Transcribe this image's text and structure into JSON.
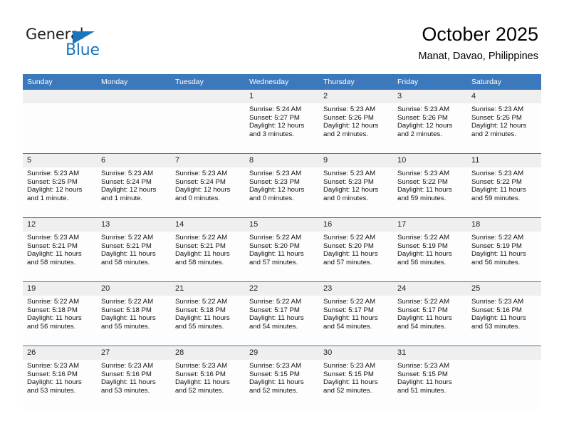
{
  "logo": {
    "word_top": "General",
    "word_bottom": "Blue",
    "triangle_color": "#1b75bb",
    "text_color": "#231f20"
  },
  "header": {
    "title": "October 2025",
    "subtitle": "Manat, Davao, Philippines"
  },
  "colors": {
    "header_bar": "#3c78bc",
    "header_text": "#ffffff",
    "daynum_band": "#efefef",
    "row_divider": "#3c78bc",
    "cell_background": "#fdfdfd",
    "body_text": "#111111"
  },
  "weekday_headers": [
    "Sunday",
    "Monday",
    "Tuesday",
    "Wednesday",
    "Thursday",
    "Friday",
    "Saturday"
  ],
  "calendar": {
    "weeks": [
      [
        {
          "day": "",
          "sunrise": "",
          "sunset": "",
          "daylight1": "",
          "daylight2": ""
        },
        {
          "day": "",
          "sunrise": "",
          "sunset": "",
          "daylight1": "",
          "daylight2": ""
        },
        {
          "day": "",
          "sunrise": "",
          "sunset": "",
          "daylight1": "",
          "daylight2": ""
        },
        {
          "day": "1",
          "sunrise": "Sunrise: 5:24 AM",
          "sunset": "Sunset: 5:27 PM",
          "daylight1": "Daylight: 12 hours",
          "daylight2": "and 3 minutes."
        },
        {
          "day": "2",
          "sunrise": "Sunrise: 5:23 AM",
          "sunset": "Sunset: 5:26 PM",
          "daylight1": "Daylight: 12 hours",
          "daylight2": "and 2 minutes."
        },
        {
          "day": "3",
          "sunrise": "Sunrise: 5:23 AM",
          "sunset": "Sunset: 5:26 PM",
          "daylight1": "Daylight: 12 hours",
          "daylight2": "and 2 minutes."
        },
        {
          "day": "4",
          "sunrise": "Sunrise: 5:23 AM",
          "sunset": "Sunset: 5:25 PM",
          "daylight1": "Daylight: 12 hours",
          "daylight2": "and 2 minutes."
        }
      ],
      [
        {
          "day": "5",
          "sunrise": "Sunrise: 5:23 AM",
          "sunset": "Sunset: 5:25 PM",
          "daylight1": "Daylight: 12 hours",
          "daylight2": "and 1 minute."
        },
        {
          "day": "6",
          "sunrise": "Sunrise: 5:23 AM",
          "sunset": "Sunset: 5:24 PM",
          "daylight1": "Daylight: 12 hours",
          "daylight2": "and 1 minute."
        },
        {
          "day": "7",
          "sunrise": "Sunrise: 5:23 AM",
          "sunset": "Sunset: 5:24 PM",
          "daylight1": "Daylight: 12 hours",
          "daylight2": "and 0 minutes."
        },
        {
          "day": "8",
          "sunrise": "Sunrise: 5:23 AM",
          "sunset": "Sunset: 5:23 PM",
          "daylight1": "Daylight: 12 hours",
          "daylight2": "and 0 minutes."
        },
        {
          "day": "9",
          "sunrise": "Sunrise: 5:23 AM",
          "sunset": "Sunset: 5:23 PM",
          "daylight1": "Daylight: 12 hours",
          "daylight2": "and 0 minutes."
        },
        {
          "day": "10",
          "sunrise": "Sunrise: 5:23 AM",
          "sunset": "Sunset: 5:22 PM",
          "daylight1": "Daylight: 11 hours",
          "daylight2": "and 59 minutes."
        },
        {
          "day": "11",
          "sunrise": "Sunrise: 5:23 AM",
          "sunset": "Sunset: 5:22 PM",
          "daylight1": "Daylight: 11 hours",
          "daylight2": "and 59 minutes."
        }
      ],
      [
        {
          "day": "12",
          "sunrise": "Sunrise: 5:23 AM",
          "sunset": "Sunset: 5:21 PM",
          "daylight1": "Daylight: 11 hours",
          "daylight2": "and 58 minutes."
        },
        {
          "day": "13",
          "sunrise": "Sunrise: 5:22 AM",
          "sunset": "Sunset: 5:21 PM",
          "daylight1": "Daylight: 11 hours",
          "daylight2": "and 58 minutes."
        },
        {
          "day": "14",
          "sunrise": "Sunrise: 5:22 AM",
          "sunset": "Sunset: 5:21 PM",
          "daylight1": "Daylight: 11 hours",
          "daylight2": "and 58 minutes."
        },
        {
          "day": "15",
          "sunrise": "Sunrise: 5:22 AM",
          "sunset": "Sunset: 5:20 PM",
          "daylight1": "Daylight: 11 hours",
          "daylight2": "and 57 minutes."
        },
        {
          "day": "16",
          "sunrise": "Sunrise: 5:22 AM",
          "sunset": "Sunset: 5:20 PM",
          "daylight1": "Daylight: 11 hours",
          "daylight2": "and 57 minutes."
        },
        {
          "day": "17",
          "sunrise": "Sunrise: 5:22 AM",
          "sunset": "Sunset: 5:19 PM",
          "daylight1": "Daylight: 11 hours",
          "daylight2": "and 56 minutes."
        },
        {
          "day": "18",
          "sunrise": "Sunrise: 5:22 AM",
          "sunset": "Sunset: 5:19 PM",
          "daylight1": "Daylight: 11 hours",
          "daylight2": "and 56 minutes."
        }
      ],
      [
        {
          "day": "19",
          "sunrise": "Sunrise: 5:22 AM",
          "sunset": "Sunset: 5:18 PM",
          "daylight1": "Daylight: 11 hours",
          "daylight2": "and 56 minutes."
        },
        {
          "day": "20",
          "sunrise": "Sunrise: 5:22 AM",
          "sunset": "Sunset: 5:18 PM",
          "daylight1": "Daylight: 11 hours",
          "daylight2": "and 55 minutes."
        },
        {
          "day": "21",
          "sunrise": "Sunrise: 5:22 AM",
          "sunset": "Sunset: 5:18 PM",
          "daylight1": "Daylight: 11 hours",
          "daylight2": "and 55 minutes."
        },
        {
          "day": "22",
          "sunrise": "Sunrise: 5:22 AM",
          "sunset": "Sunset: 5:17 PM",
          "daylight1": "Daylight: 11 hours",
          "daylight2": "and 54 minutes."
        },
        {
          "day": "23",
          "sunrise": "Sunrise: 5:22 AM",
          "sunset": "Sunset: 5:17 PM",
          "daylight1": "Daylight: 11 hours",
          "daylight2": "and 54 minutes."
        },
        {
          "day": "24",
          "sunrise": "Sunrise: 5:22 AM",
          "sunset": "Sunset: 5:17 PM",
          "daylight1": "Daylight: 11 hours",
          "daylight2": "and 54 minutes."
        },
        {
          "day": "25",
          "sunrise": "Sunrise: 5:23 AM",
          "sunset": "Sunset: 5:16 PM",
          "daylight1": "Daylight: 11 hours",
          "daylight2": "and 53 minutes."
        }
      ],
      [
        {
          "day": "26",
          "sunrise": "Sunrise: 5:23 AM",
          "sunset": "Sunset: 5:16 PM",
          "daylight1": "Daylight: 11 hours",
          "daylight2": "and 53 minutes."
        },
        {
          "day": "27",
          "sunrise": "Sunrise: 5:23 AM",
          "sunset": "Sunset: 5:16 PM",
          "daylight1": "Daylight: 11 hours",
          "daylight2": "and 53 minutes."
        },
        {
          "day": "28",
          "sunrise": "Sunrise: 5:23 AM",
          "sunset": "Sunset: 5:16 PM",
          "daylight1": "Daylight: 11 hours",
          "daylight2": "and 52 minutes."
        },
        {
          "day": "29",
          "sunrise": "Sunrise: 5:23 AM",
          "sunset": "Sunset: 5:15 PM",
          "daylight1": "Daylight: 11 hours",
          "daylight2": "and 52 minutes."
        },
        {
          "day": "30",
          "sunrise": "Sunrise: 5:23 AM",
          "sunset": "Sunset: 5:15 PM",
          "daylight1": "Daylight: 11 hours",
          "daylight2": "and 52 minutes."
        },
        {
          "day": "31",
          "sunrise": "Sunrise: 5:23 AM",
          "sunset": "Sunset: 5:15 PM",
          "daylight1": "Daylight: 11 hours",
          "daylight2": "and 51 minutes."
        },
        {
          "day": "",
          "sunrise": "",
          "sunset": "",
          "daylight1": "",
          "daylight2": ""
        }
      ]
    ]
  }
}
